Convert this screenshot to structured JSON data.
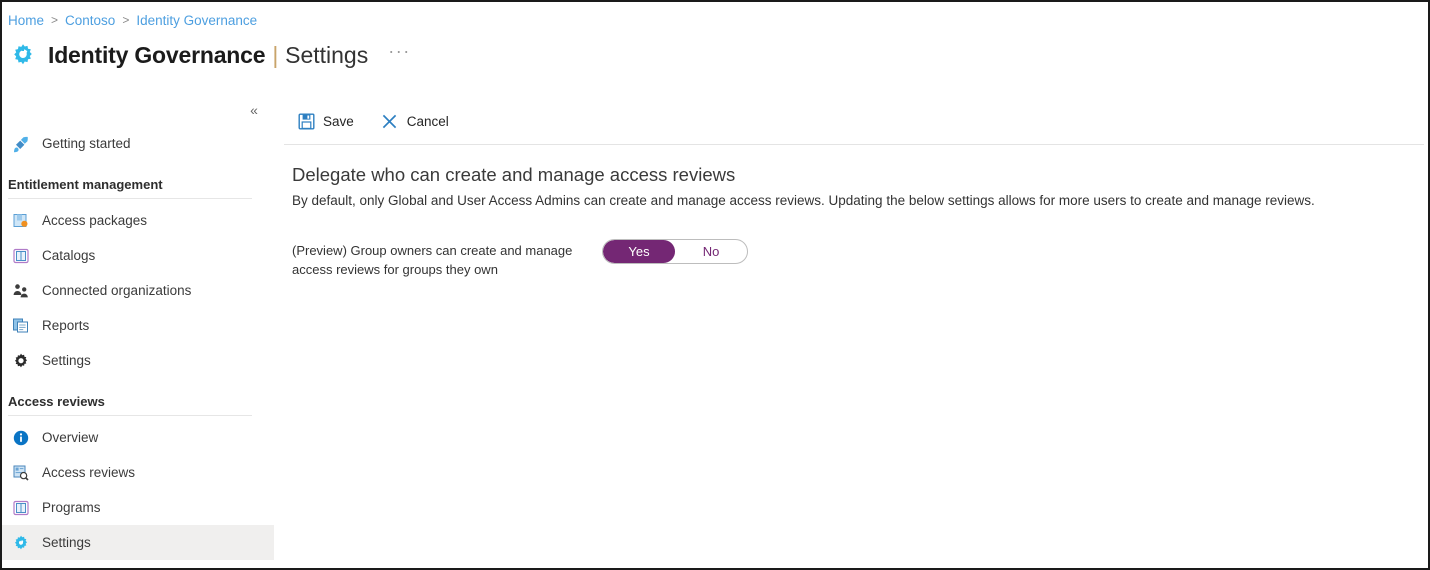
{
  "breadcrumb": {
    "separator": ">",
    "items": [
      {
        "label": "Home"
      },
      {
        "label": "Contoso"
      },
      {
        "label": "Identity Governance"
      }
    ]
  },
  "header": {
    "icon": "gear-icon",
    "title": "Identity Governance",
    "divider": "|",
    "subtitle": "Settings",
    "more_menu": "···"
  },
  "sidebar": {
    "collapse_icon": "«",
    "top_items": [
      {
        "label": "Getting started",
        "icon": "rocket-icon",
        "selected": false
      }
    ],
    "sections": [
      {
        "title": "Entitlement management",
        "items": [
          {
            "label": "Access packages",
            "icon": "package-icon",
            "selected": false
          },
          {
            "label": "Catalogs",
            "icon": "book-icon",
            "selected": false
          },
          {
            "label": "Connected organizations",
            "icon": "people-icon",
            "selected": false
          },
          {
            "label": "Reports",
            "icon": "report-icon",
            "selected": false
          },
          {
            "label": "Settings",
            "icon": "gear-dark-icon",
            "selected": false
          }
        ]
      },
      {
        "title": "Access reviews",
        "items": [
          {
            "label": "Overview",
            "icon": "info-icon",
            "selected": false
          },
          {
            "label": "Access reviews",
            "icon": "document-search-icon",
            "selected": false
          },
          {
            "label": "Programs",
            "icon": "book-icon",
            "selected": false
          },
          {
            "label": "Settings",
            "icon": "gear-cyan-icon",
            "selected": true
          }
        ]
      }
    ]
  },
  "toolbar": {
    "save_label": "Save",
    "save_icon": "save-disk-icon",
    "cancel_label": "Cancel",
    "cancel_icon": "close-x-icon"
  },
  "main": {
    "heading": "Delegate who can create and manage access reviews",
    "description": "By default, only Global and User Access Admins can create and manage access reviews. Updating the below settings allows for more users to create and manage reviews.",
    "setting": {
      "label": "(Preview) Group owners can create and manage access reviews for groups they own",
      "toggle": {
        "on_label": "Yes",
        "off_label": "No",
        "value": "Yes"
      }
    }
  },
  "colors": {
    "accent_blue": "#0078d4",
    "breadcrumb_link": "#4d9fe0",
    "toggle_purple": "#742774",
    "selected_row": "#f0efee",
    "cyan_icon": "#2fb9e8"
  }
}
